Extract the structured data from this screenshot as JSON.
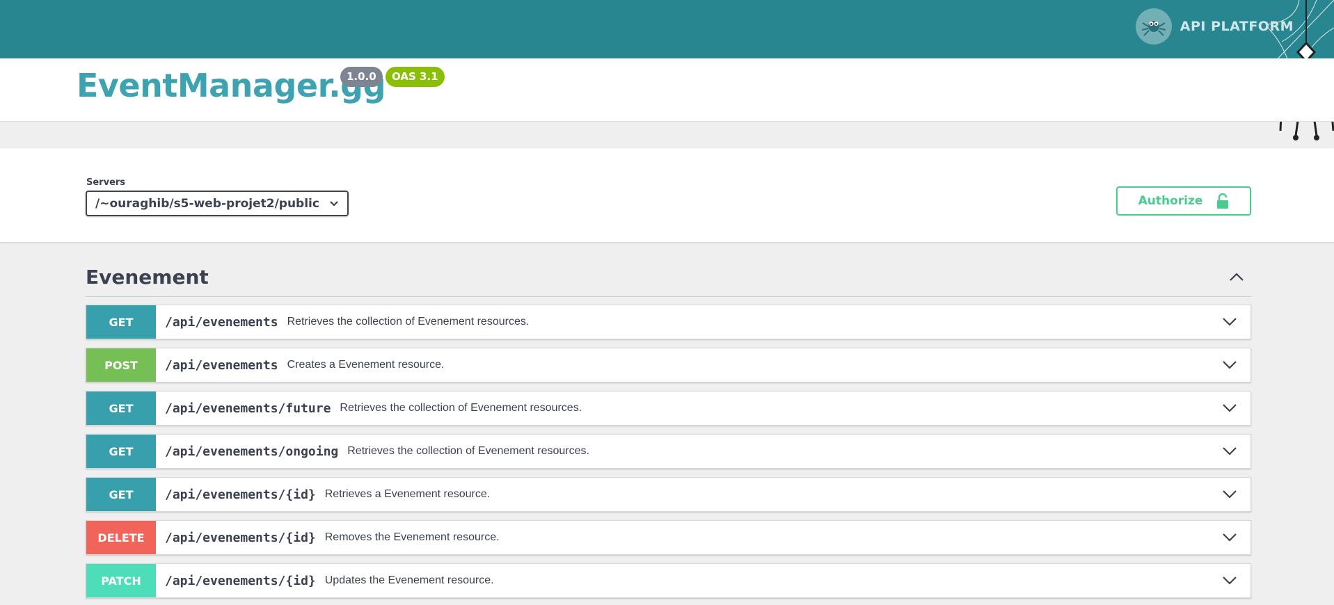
{
  "header": {
    "brand_text": "API PLATFORM",
    "brand_icon": "spider-logo-icon",
    "background": "#288690"
  },
  "info": {
    "title": "EventManager.gg",
    "version": "1.0.0",
    "oas": "OAS 3.1"
  },
  "scheme": {
    "servers_label": "Servers",
    "selected_server": "/~ouraghib/s5-web-projet2/public",
    "authorize_label": "Authorize",
    "authorize_icon": "unlock-icon",
    "authorize_color": "#49cc90"
  },
  "tag": {
    "name": "Evenement",
    "toggle_icon": "chevron-up-icon",
    "operations": [
      {
        "method": "GET",
        "path": "/api/evenements",
        "summary": "Retrieves the collection of Evenement resources.",
        "color": "#38a0ac"
      },
      {
        "method": "POST",
        "path": "/api/evenements",
        "summary": "Creates a Evenement resource.",
        "color": "#76bf55"
      },
      {
        "method": "GET",
        "path": "/api/evenements/future",
        "summary": "Retrieves the collection of Evenement resources.",
        "color": "#38a0ac"
      },
      {
        "method": "GET",
        "path": "/api/evenements/ongoing",
        "summary": "Retrieves the collection of Evenement resources.",
        "color": "#38a0ac"
      },
      {
        "method": "GET",
        "path": "/api/evenements/{id}",
        "summary": "Retrieves a Evenement resource.",
        "color": "#38a0ac"
      },
      {
        "method": "DELETE",
        "path": "/api/evenements/{id}",
        "summary": "Removes the Evenement resource.",
        "color": "#f0645a"
      },
      {
        "method": "PATCH",
        "path": "/api/evenements/{id}",
        "summary": "Updates the Evenement resource.",
        "color": "#4dddb8"
      }
    ]
  }
}
